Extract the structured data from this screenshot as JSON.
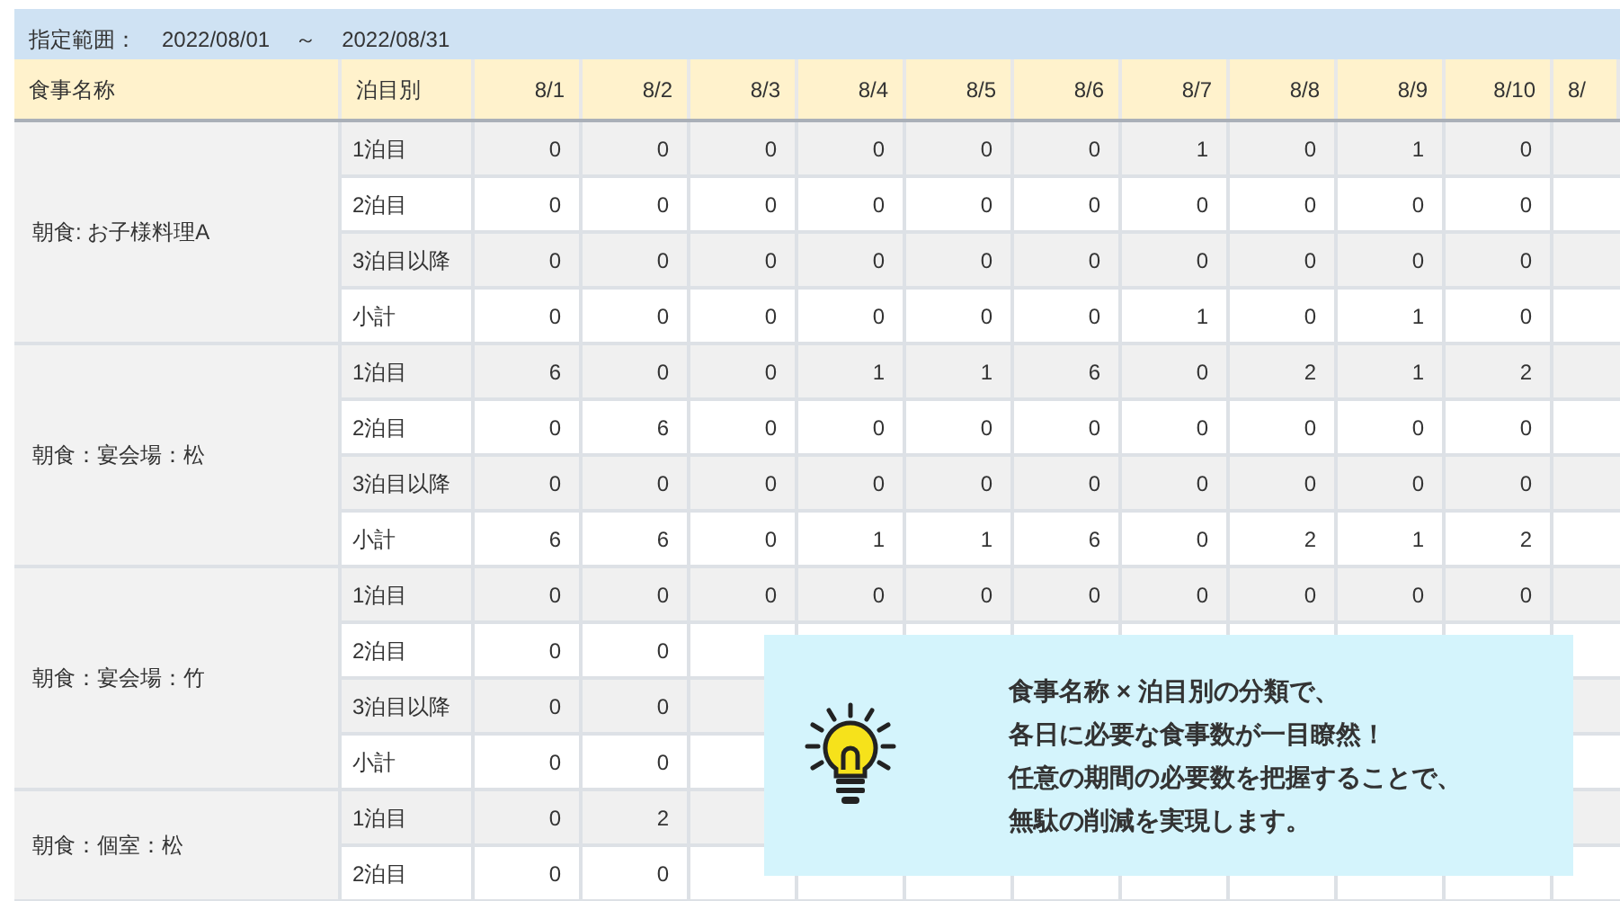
{
  "date_range": {
    "label": "指定範囲：",
    "from": "2022/08/01",
    "separator": "～",
    "to": "2022/08/31"
  },
  "table": {
    "columns": [
      "食事名称",
      "泊目別",
      "8/1",
      "8/2",
      "8/3",
      "8/4",
      "8/5",
      "8/6",
      "8/7",
      "8/8",
      "8/9",
      "8/10",
      "8/"
    ],
    "groups": [
      {
        "name": "朝食: お子様料理A",
        "rows": [
          {
            "stay": "1泊目",
            "values": [
              "0",
              "0",
              "0",
              "0",
              "0",
              "0",
              "1",
              "0",
              "1",
              "0"
            ]
          },
          {
            "stay": "2泊目",
            "values": [
              "0",
              "0",
              "0",
              "0",
              "0",
              "0",
              "0",
              "0",
              "0",
              "0"
            ]
          },
          {
            "stay": "3泊目以降",
            "values": [
              "0",
              "0",
              "0",
              "0",
              "0",
              "0",
              "0",
              "0",
              "0",
              "0"
            ]
          },
          {
            "stay": "小計",
            "values": [
              "0",
              "0",
              "0",
              "0",
              "0",
              "0",
              "1",
              "0",
              "1",
              "0"
            ]
          }
        ]
      },
      {
        "name": "朝食：宴会場：松",
        "rows": [
          {
            "stay": "1泊目",
            "values": [
              "6",
              "0",
              "0",
              "1",
              "1",
              "6",
              "0",
              "2",
              "1",
              "2"
            ]
          },
          {
            "stay": "2泊目",
            "values": [
              "0",
              "6",
              "0",
              "0",
              "0",
              "0",
              "0",
              "0",
              "0",
              "0"
            ]
          },
          {
            "stay": "3泊目以降",
            "values": [
              "0",
              "0",
              "0",
              "0",
              "0",
              "0",
              "0",
              "0",
              "0",
              "0"
            ]
          },
          {
            "stay": "小計",
            "values": [
              "6",
              "6",
              "0",
              "1",
              "1",
              "6",
              "0",
              "2",
              "1",
              "2"
            ]
          }
        ]
      },
      {
        "name": "朝食：宴会場：竹",
        "rows": [
          {
            "stay": "1泊目",
            "values": [
              "0",
              "0",
              "0",
              "0",
              "0",
              "0",
              "0",
              "0",
              "0",
              "0"
            ]
          },
          {
            "stay": "2泊目",
            "values": [
              "0",
              "0"
            ]
          },
          {
            "stay": "3泊目以降",
            "values": [
              "0",
              "0"
            ]
          },
          {
            "stay": "小計",
            "values": [
              "0",
              "0"
            ]
          }
        ]
      },
      {
        "name": "朝食：個室：松",
        "rows": [
          {
            "stay": "1泊目",
            "values": [
              "0",
              "2"
            ]
          },
          {
            "stay": "2泊目",
            "values": [
              "0",
              "0"
            ]
          }
        ]
      }
    ]
  },
  "callout": {
    "lines": [
      "食事名称 × 泊目別の分類で、",
      "各日に必要な食事数が一目瞭然！",
      "任意の期間の必要数を把握することで、",
      "無駄の削減を実現します。"
    ]
  }
}
